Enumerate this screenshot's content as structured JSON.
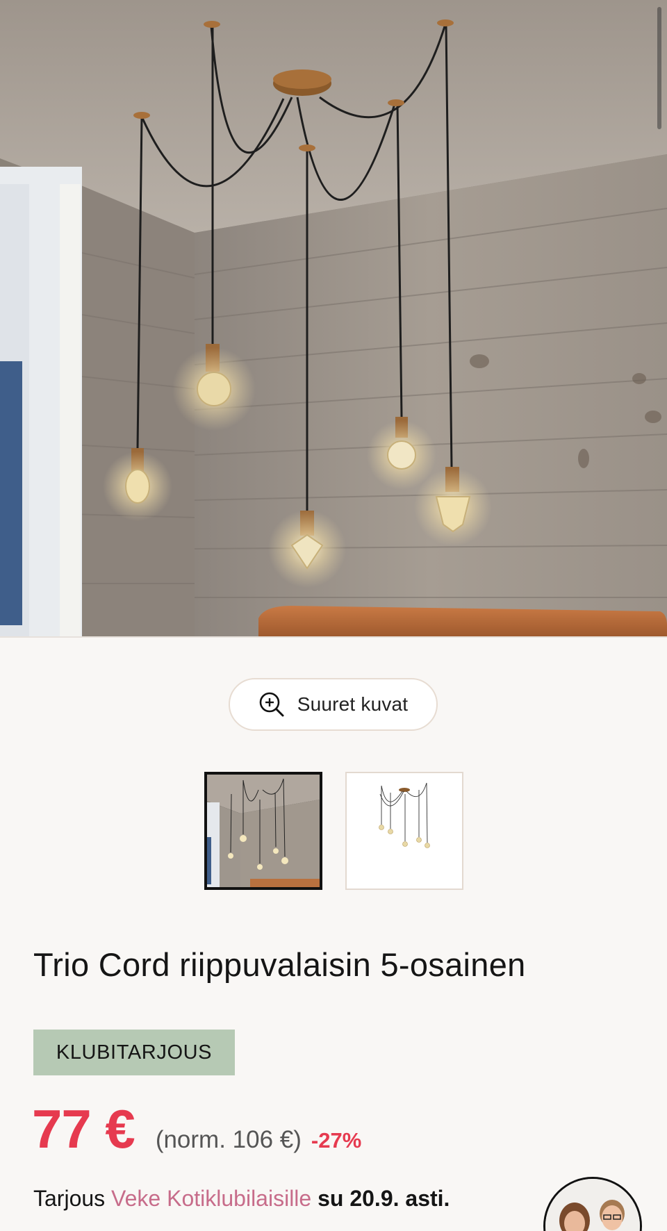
{
  "gallery": {
    "zoom_button_label": "Suuret kuvat",
    "main_image_icon": "room-with-pendant-lights",
    "thumbnails": [
      "room-photo-thumbnail",
      "product-cutout-thumbnail"
    ],
    "selected_thumbnail": 1
  },
  "product": {
    "title": "Trio Cord riippuvalaisin 5-osainen",
    "badge": "KLUBITARJOUS",
    "price": "77 €",
    "normal_price": "(norm. 106 €)",
    "discount": "-27%",
    "offer": {
      "prefix": "Tarjous",
      "club": "Veke Kotiklubilaisille",
      "until": "su 20.9. asti."
    }
  },
  "colors": {
    "accent": "#e63a4f",
    "badge_bg": "#b6c9b4",
    "club_link": "#c76c8a",
    "background": "#f9f7f5"
  }
}
